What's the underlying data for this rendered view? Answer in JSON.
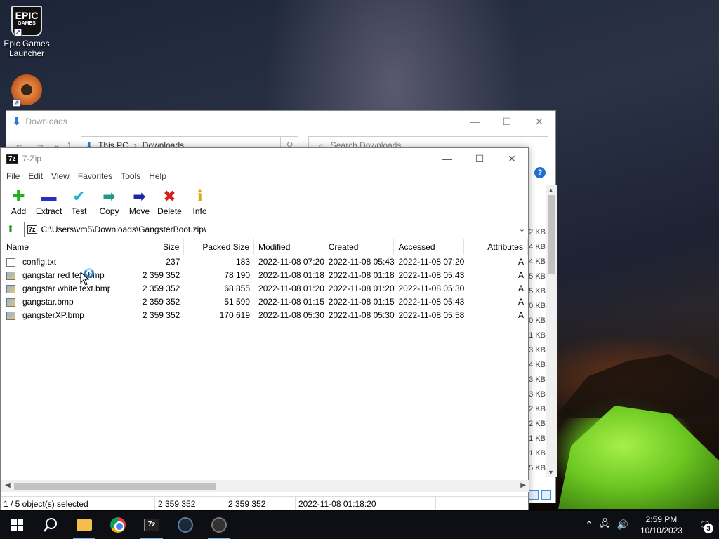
{
  "desktop": {
    "icons": [
      {
        "label": "Epic Games Launcher",
        "icon": "epic-games-icon",
        "logo_text": "EPIC",
        "logo_sub": "GAMES"
      },
      {
        "label": "Team Fortress 2",
        "icon": "tf2-icon"
      }
    ]
  },
  "explorer": {
    "title": "Downloads",
    "breadcrumb": [
      "This PC",
      "Downloads"
    ],
    "search_placeholder": "Search Downloads",
    "right_sizes": [
      "2 KB",
      "4 KB",
      "4 KB",
      "5 KB",
      "5 KB",
      "0 KB",
      "0 KB",
      "1 KB",
      "3 KB",
      "4 KB",
      "3 KB",
      "3 KB",
      "2 KB",
      "2 KB",
      "1 KB",
      "1 KB",
      "5 KB"
    ]
  },
  "zip": {
    "title": "7-Zip",
    "menu": [
      "File",
      "Edit",
      "View",
      "Favorites",
      "Tools",
      "Help"
    ],
    "toolbar": [
      {
        "label": "Add",
        "icon": "plus-icon",
        "glyph": "✚"
      },
      {
        "label": "Extract",
        "icon": "minus-icon",
        "glyph": "▬"
      },
      {
        "label": "Test",
        "icon": "check-icon",
        "glyph": "✔"
      },
      {
        "label": "Copy",
        "icon": "copy-arrow-icon",
        "glyph": "➡"
      },
      {
        "label": "Move",
        "icon": "move-arrow-icon",
        "glyph": "➡"
      },
      {
        "label": "Delete",
        "icon": "delete-x-icon",
        "glyph": "✖"
      },
      {
        "label": "Info",
        "icon": "info-icon",
        "glyph": "ℹ"
      }
    ],
    "path": "C:\\Users\\vm5\\Downloads\\GangsterBoot.zip\\",
    "columns": [
      "Name",
      "Size",
      "Packed Size",
      "Modified",
      "Created",
      "Accessed",
      "Attributes"
    ],
    "files": [
      {
        "name": "config.txt",
        "type": "txt",
        "size": "237",
        "packed": "183",
        "modified": "2022-11-08 07:20",
        "created": "2022-11-08 05:43",
        "accessed": "2022-11-08 07:20",
        "attr": "A"
      },
      {
        "name": "gangstar red text.bmp",
        "type": "bmp",
        "size": "2 359 352",
        "packed": "78 190",
        "modified": "2022-11-08 01:18",
        "created": "2022-11-08 01:18",
        "accessed": "2022-11-08 05:43",
        "attr": "A"
      },
      {
        "name": "gangstar white text.bmp",
        "type": "bmp",
        "size": "2 359 352",
        "packed": "68 855",
        "modified": "2022-11-08 01:20",
        "created": "2022-11-08 01:20",
        "accessed": "2022-11-08 05:30",
        "attr": "A"
      },
      {
        "name": "gangstar.bmp",
        "type": "bmp",
        "size": "2 359 352",
        "packed": "51 599",
        "modified": "2022-11-08 01:15",
        "created": "2022-11-08 01:15",
        "accessed": "2022-11-08 05:43",
        "attr": "A"
      },
      {
        "name": "gangsterXP.bmp",
        "type": "bmp",
        "size": "2 359 352",
        "packed": "170 619",
        "modified": "2022-11-08 05:30",
        "created": "2022-11-08 05:30",
        "accessed": "2022-11-08 05:58",
        "attr": "A"
      }
    ],
    "status": {
      "selection": "1 / 5 object(s) selected",
      "size": "2 359 352",
      "packed": "2 359 352",
      "modified": "2022-11-08 01:18:20"
    }
  },
  "taskbar": {
    "apps": [
      "start-icon",
      "search-icon",
      "file-explorer-icon",
      "chrome-icon",
      "7zip-icon",
      "steam-icon",
      "game-icon"
    ],
    "sevenzip_label": "7z",
    "time": "2:59 PM",
    "date": "10/10/2023",
    "notification_count": "3"
  }
}
